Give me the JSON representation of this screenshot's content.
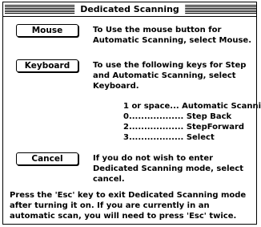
{
  "dialog": {
    "title": "Dedicated Scanning"
  },
  "options": [
    {
      "button_label": "Mouse",
      "description": "To Use the mouse button for Automatic Scanning, select Mouse."
    },
    {
      "button_label": "Keyboard",
      "description": "To use the following keys for Step and Automatic Scanning, select Keyboard."
    },
    {
      "button_label": "Cancel",
      "description": "If you do not wish to enter Dedicated Scanning mode, select cancel."
    }
  ],
  "key_mappings": [
    "1 or space... Automatic Scanning",
    "0.................. Step Back",
    "2.................. StepForward",
    "3.................. Select"
  ],
  "footer_text": "Press the 'Esc' key to exit Dedicated Scanning mode after turning it on. If you are currently in an automatic scan, you will need to press 'Esc' twice."
}
